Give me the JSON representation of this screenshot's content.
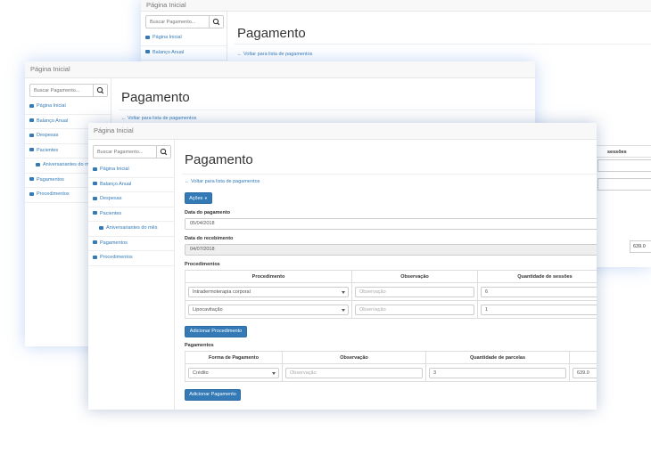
{
  "app": {
    "home_title": "Página Inicial",
    "search_placeholder": "Buscar Pagamento...",
    "page_title": "Pagamento",
    "back_link": "Voltar para lista de pagamentos"
  },
  "sidebar": {
    "items": [
      {
        "label": "Página Inicial",
        "icon": "dashboard-icon"
      },
      {
        "label": "Balanço Anual",
        "icon": "list-icon"
      },
      {
        "label": "Despesas",
        "icon": "list-icon"
      },
      {
        "label": "Pacientes",
        "icon": "list-icon"
      },
      {
        "label": "Aniversariantes do mês",
        "icon": "birthday-cake-icon"
      },
      {
        "label": "Pagamentos",
        "icon": "list-icon"
      },
      {
        "label": "Procedimentos",
        "icon": "list-icon"
      }
    ]
  },
  "form": {
    "actions_label": "Ações",
    "date_payment_label": "Data do pagamento",
    "date_payment_value": "05/04/2018",
    "date_received_label": "Data do recebimento",
    "date_received_value": "04/07/2018",
    "procedures_label": "Procedimentos",
    "procedures_table": {
      "headers": [
        "Procedimento",
        "Observação",
        "Quantidade de sessões"
      ],
      "rows": [
        {
          "procedure": "Intradermoterapia corporal",
          "observation": "Observação",
          "sessions": "6"
        },
        {
          "procedure": "Lipocavitação",
          "observation": "Observação",
          "sessions": "1"
        }
      ]
    },
    "add_procedure_label": "Adicionar Procedimento",
    "payments_label": "Pagamentos",
    "payments_table": {
      "headers": [
        "Forma de Pagamento",
        "Observação",
        "Quantidade de parcelas"
      ],
      "rows": [
        {
          "method": "Crédito",
          "observation": "Observação",
          "installments": "3",
          "amount": "639.0"
        }
      ]
    },
    "add_payment_label": "Adicionar Pagamento"
  },
  "background": {
    "sessions_header_fragment": "sessões",
    "amount_value": "639.0"
  },
  "colors": {
    "link": "#337ab7",
    "primary_button": "#337ab7",
    "glow": "#7fb0ff"
  }
}
